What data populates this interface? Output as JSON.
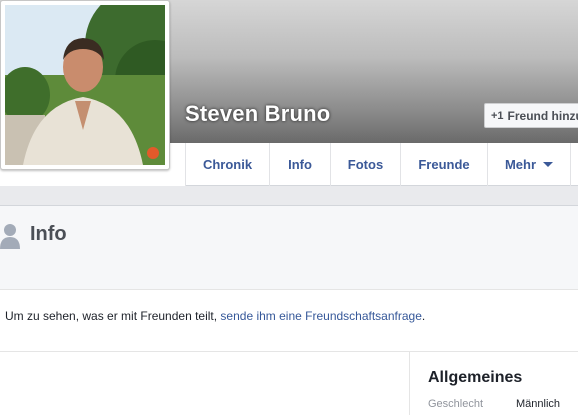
{
  "profile": {
    "name": "Steven Bruno",
    "add_friend_label": "Freund hinzufügen",
    "add_friend_icon": "add-friend-icon"
  },
  "nav": {
    "tabs": [
      {
        "label": "Chronik"
      },
      {
        "label": "Info"
      },
      {
        "label": "Fotos"
      },
      {
        "label": "Freunde"
      },
      {
        "label": "Mehr"
      }
    ]
  },
  "info": {
    "title": "Info",
    "notice_prefix": "Um zu sehen, was er mit Freunden teilt, ",
    "notice_link": "sende ihm eine Freundschaftsanfrage",
    "notice_suffix": ".",
    "general": {
      "title": "Allgemeines",
      "gender_label": "Geschlecht",
      "gender_value": "Männlich"
    }
  },
  "colors": {
    "link": "#3b5998",
    "page_bg": "#e9eaed"
  }
}
